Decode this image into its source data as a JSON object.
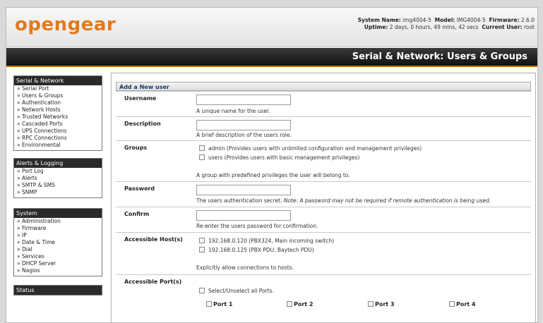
{
  "header": {
    "logo": "opengear",
    "system_name_label": "System Name:",
    "system_name": "img4004-5",
    "model_label": "Model:",
    "model": "IMG4004-5",
    "firmware_label": "Firmware:",
    "firmware": "2.6.0",
    "uptime_label": "Uptime:",
    "uptime": "2 days, 0 hours, 49 mins, 42 secs",
    "current_user_label": "Current User:",
    "current_user": "root"
  },
  "page_title": "Serial & Network: Users & Groups",
  "sidebar": {
    "serial_network": {
      "title": "Serial & Network",
      "items": [
        "Serial Port",
        "Users & Groups",
        "Authentication",
        "Network Hosts",
        "Trusted Networks",
        "Cascaded Ports",
        "UPS Connections",
        "RPC Connections",
        "Environmental"
      ]
    },
    "alerts_logging": {
      "title": "Alerts & Logging",
      "items": [
        "Port Log",
        "Alerts",
        "SMTP & SMS",
        "SNMP"
      ]
    },
    "system": {
      "title": "System",
      "items": [
        "Administration",
        "Firmware",
        "IP",
        "Date & Time",
        "Dial",
        "Services",
        "DHCP Server",
        "Nagios"
      ]
    },
    "status": {
      "title": "Status"
    }
  },
  "form": {
    "section_title": "Add a New user",
    "username": {
      "label": "Username",
      "value": "",
      "help": "A unique name for the user."
    },
    "description": {
      "label": "Description",
      "value": "",
      "help": "A brief description of the users role."
    },
    "groups": {
      "label": "Groups",
      "options": [
        "admin (Provides users with unlimited configuration and management privileges)",
        "users (Provides users with basic management privileges)"
      ],
      "help": "A group with predefined privileges the user will belong to."
    },
    "password": {
      "label": "Password",
      "value": "",
      "help": "The users authentication secret.",
      "note": "Note: A password may not be required if remote authentication is being used."
    },
    "confirm": {
      "label": "Confirm",
      "value": "",
      "help": "Re-enter the users password for confirmation."
    },
    "accessible_hosts": {
      "label": "Accessible Host(s)",
      "options": [
        "192.168.0.120 (PBX324, Main incoming switch)",
        "192.168.0.125 (PBX PDU, Baytech PDU)"
      ],
      "help": "Explicitly allow connections to hosts."
    },
    "accessible_ports": {
      "label": "Accessible Port(s)",
      "select_all": "Select/Unselect all Ports.",
      "ports": [
        "Port 1",
        "Port 2",
        "Port 3",
        "Port 4"
      ]
    }
  }
}
